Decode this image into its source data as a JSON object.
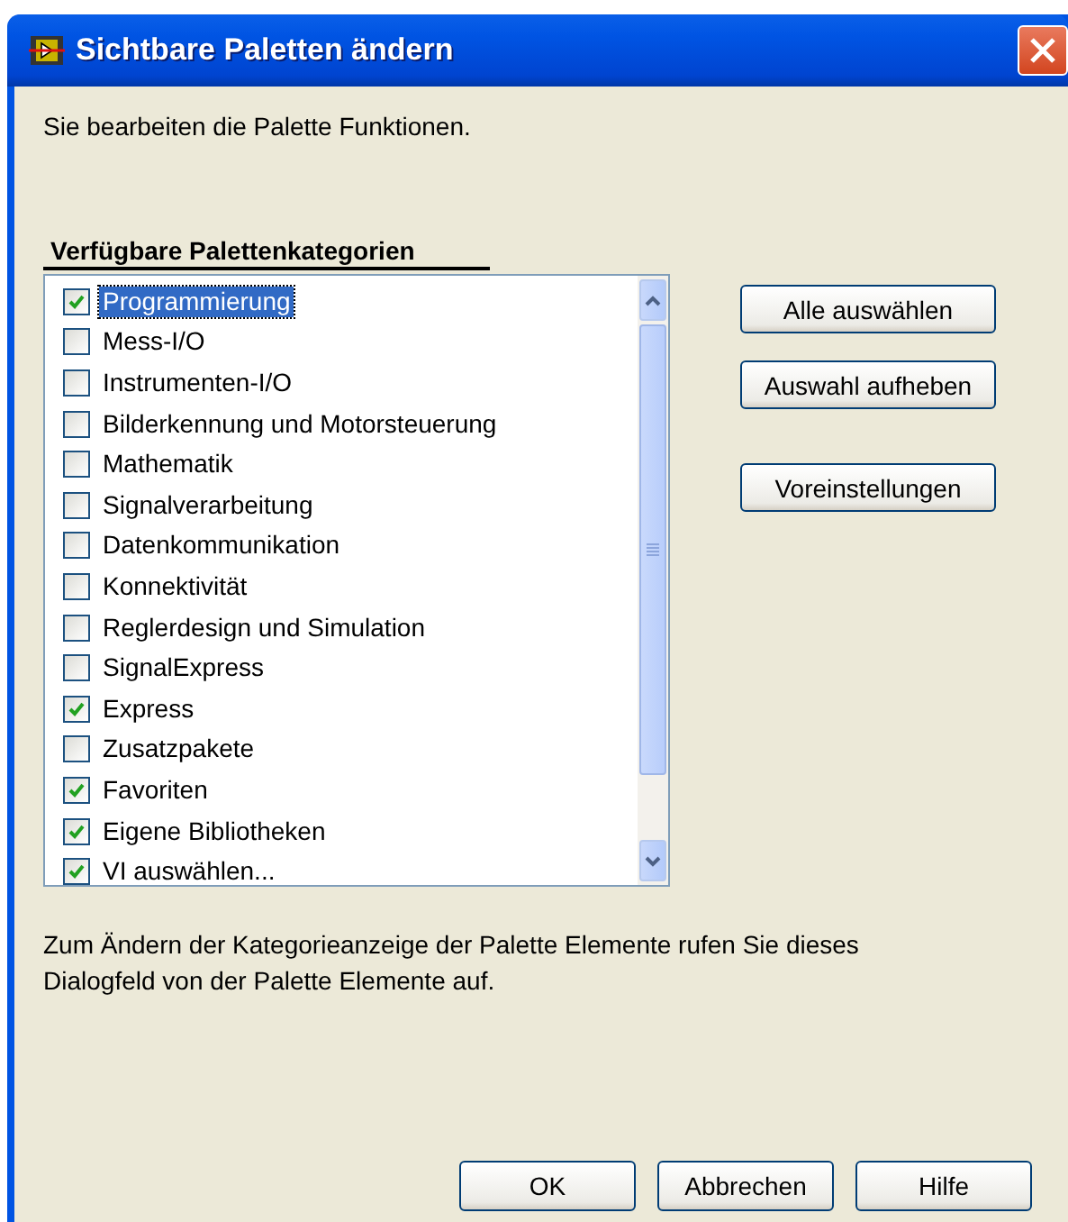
{
  "window": {
    "title": "Sichtbare Paletten ändern"
  },
  "intro": "Sie bearbeiten die Palette Funktionen.",
  "list": {
    "heading": "Verfügbare Palettenkategorien",
    "items": [
      {
        "label": "Programmierung",
        "checked": true,
        "selected": true
      },
      {
        "label": "Mess-I/O",
        "checked": false,
        "selected": false
      },
      {
        "label": "Instrumenten-I/O",
        "checked": false,
        "selected": false
      },
      {
        "label": "Bilderkennung und Motorsteuerung",
        "checked": false,
        "selected": false
      },
      {
        "label": "Mathematik",
        "checked": false,
        "selected": false
      },
      {
        "label": "Signalverarbeitung",
        "checked": false,
        "selected": false
      },
      {
        "label": "Datenkommunikation",
        "checked": false,
        "selected": false
      },
      {
        "label": "Konnektivität",
        "checked": false,
        "selected": false
      },
      {
        "label": "Reglerdesign und Simulation",
        "checked": false,
        "selected": false
      },
      {
        "label": "SignalExpress",
        "checked": false,
        "selected": false
      },
      {
        "label": "Express",
        "checked": true,
        "selected": false
      },
      {
        "label": "Zusatzpakete",
        "checked": false,
        "selected": false
      },
      {
        "label": "Favoriten",
        "checked": true,
        "selected": false
      },
      {
        "label": "Eigene Bibliotheken",
        "checked": true,
        "selected": false
      },
      {
        "label": "VI auswählen...",
        "checked": true,
        "selected": false
      }
    ]
  },
  "side_buttons": [
    "Alle auswählen",
    "Auswahl aufheben",
    "Voreinstellungen"
  ],
  "note": "Zum Ändern der Kategorieanzeige der Palette Elemente rufen Sie dieses Dialogfeld von der Palette Elemente auf.",
  "buttons": [
    "OK",
    "Abbrechen",
    "Hilfe"
  ]
}
